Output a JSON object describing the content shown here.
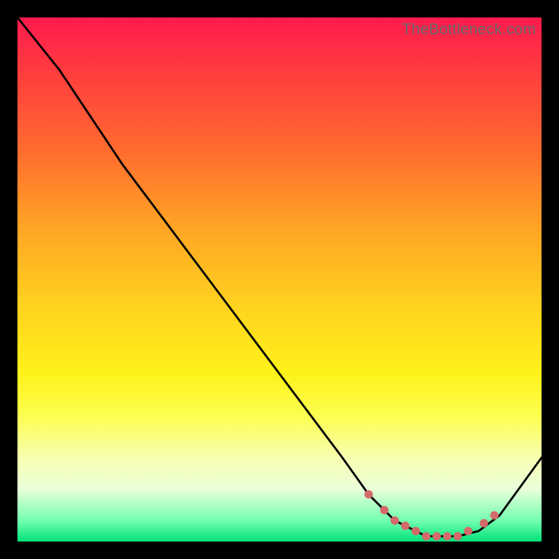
{
  "watermark": "TheBottleneck.com",
  "chart_data": {
    "type": "line",
    "title": "",
    "xlabel": "",
    "ylabel": "",
    "xlim": [
      0,
      100
    ],
    "ylim": [
      0,
      100
    ],
    "series": [
      {
        "name": "curve",
        "x": [
          0,
          8,
          20,
          35,
          50,
          62,
          67,
          72,
          78,
          84,
          88,
          92,
          100
        ],
        "y": [
          100,
          90,
          72,
          52,
          32,
          16,
          9,
          4,
          1,
          1,
          2,
          5,
          16
        ]
      }
    ],
    "markers": {
      "name": "dots",
      "x": [
        67,
        70,
        72,
        74,
        76,
        78,
        80,
        82,
        84,
        86,
        89,
        91
      ],
      "y": [
        9,
        6,
        4,
        3,
        2,
        1,
        1,
        1,
        1,
        2,
        3.5,
        5
      ]
    },
    "colors": {
      "curve": "#000000",
      "markers": "#d46a6a",
      "bg_top": "#ff1a4d",
      "bg_bottom": "#00e27a"
    }
  }
}
